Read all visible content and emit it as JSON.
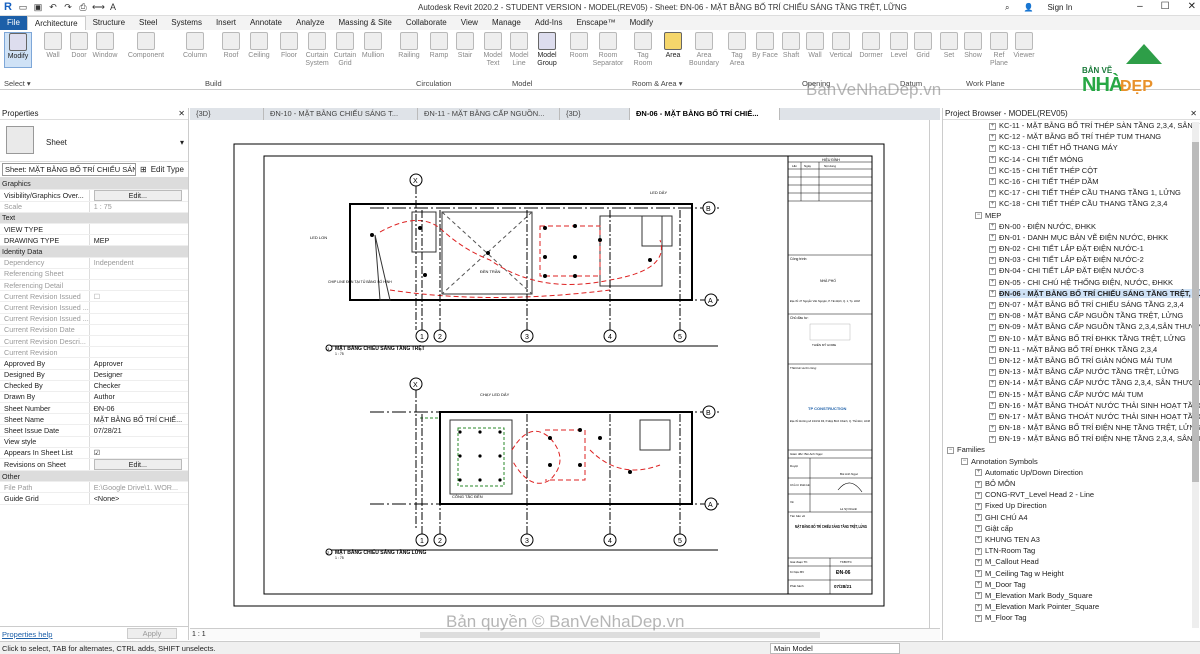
{
  "app": {
    "title": "Autodesk Revit 2020.2 - STUDENT VERSION - MODEL(REV05) - Sheet: ĐN-06 - MẶT BẰNG BỐ TRÍ CHIẾU SÁNG TẦNG TRỆT, LỮNG",
    "sign_in": "Sign In"
  },
  "tabs": [
    "File",
    "Architecture",
    "Structure",
    "Steel",
    "Systems",
    "Insert",
    "Annotate",
    "Analyze",
    "Massing & Site",
    "Collaborate",
    "View",
    "Manage",
    "Add-Ins",
    "Enscape™",
    "Modify"
  ],
  "ribbon": {
    "modify_label": "Modify",
    "tools": [
      "Wall",
      "Door",
      "Window",
      "Component",
      "Column",
      "Roof",
      "Ceiling",
      "Floor",
      "Curtain System",
      "Curtain Grid",
      "Mullion",
      "Railing",
      "Ramp",
      "Stair",
      "Model Text",
      "Model Line",
      "Model Group",
      "Room",
      "Room Separator",
      "Tag Room",
      "Area",
      "Area Boundary",
      "Tag Area",
      "By Face",
      "Shaft",
      "Wall",
      "Vertical",
      "Dormer",
      "Level",
      "Grid",
      "Set",
      "Show",
      "Ref Plane",
      "Viewer"
    ],
    "groups": [
      "Select ▾",
      "Build",
      "Circulation",
      "Model",
      "Room & Area ▾",
      "Opening",
      "Datum",
      "Work Plane"
    ]
  },
  "brand": {
    "top": "BẢN VẼ",
    "big": "NHÀ",
    "dep": "ĐẸP"
  },
  "properties": {
    "header": "Properties",
    "type_label": "Sheet",
    "instance": "Sheet: MẶT BẰNG BỐ TRÍ CHIẾU SÁN",
    "edit_type": "Edit Type",
    "rows": [
      {
        "sec": "Graphics"
      },
      {
        "k": "Visibility/Graphics Over...",
        "v": "Edit...",
        "btn": true
      },
      {
        "k": "Scale",
        "v": "1 : 75",
        "dim": true
      },
      {
        "sec": "Text"
      },
      {
        "k": "VIEW TYPE",
        "v": ""
      },
      {
        "k": "DRAWING TYPE",
        "v": "MEP"
      },
      {
        "sec": "Identity Data"
      },
      {
        "k": "Dependency",
        "v": "Independent",
        "dim": true
      },
      {
        "k": "Referencing Sheet",
        "v": "",
        "dim": true
      },
      {
        "k": "Referencing Detail",
        "v": "",
        "dim": true
      },
      {
        "k": "Current Revision Issued",
        "v": "☐",
        "dim": true
      },
      {
        "k": "Current Revision Issued ...",
        "v": "",
        "dim": true
      },
      {
        "k": "Current Revision Issued ...",
        "v": "",
        "dim": true
      },
      {
        "k": "Current Revision Date",
        "v": "",
        "dim": true
      },
      {
        "k": "Current Revision Descri...",
        "v": "",
        "dim": true
      },
      {
        "k": "Current Revision",
        "v": "",
        "dim": true
      },
      {
        "k": "Approved By",
        "v": "Approver"
      },
      {
        "k": "Designed By",
        "v": "Designer"
      },
      {
        "k": "Checked By",
        "v": "Checker"
      },
      {
        "k": "Drawn By",
        "v": "Author"
      },
      {
        "k": "Sheet Number",
        "v": "ĐN-06"
      },
      {
        "k": "Sheet Name",
        "v": "MẶT BẰNG BỐ TRÍ CHIẾ..."
      },
      {
        "k": "Sheet Issue Date",
        "v": "07/28/21"
      },
      {
        "k": "View style",
        "v": ""
      },
      {
        "k": "Appears In Sheet List",
        "v": "☑"
      },
      {
        "k": "Revisions on Sheet",
        "v": "Edit...",
        "btn": true
      },
      {
        "sec": "Other"
      },
      {
        "k": "File Path",
        "v": "E:\\Google Drive\\1. WOR...",
        "dim": true
      },
      {
        "k": "Guide Grid",
        "v": "<None>"
      }
    ],
    "help": "Properties help",
    "apply": "Apply"
  },
  "view_tabs": [
    "{3D}",
    "ĐN-10 - MẶT BẰNG CHIẾU SÁNG T...",
    "ĐN-11 - MẶT BẰNG CẤP NGUỒN...",
    "{3D}",
    "ĐN-06 - MẶT BẰNG BỐ TRÍ CHIẾ..."
  ],
  "sheet": {
    "plan1_title": "MẶT BẰNG CHIẾU SÁNG TẦNG TRỆT",
    "plan1_num": "1",
    "plan1_scale": "1 : 75",
    "plan2_title": "MẶT BẰNG CHIẾU SÁNG TẦNG LỬNG",
    "plan2_num": "2",
    "plan2_scale": "1 : 75",
    "grids": [
      "1",
      "2",
      "3",
      "4",
      "5"
    ],
    "grid_x": "X",
    "grid_a": "A",
    "grid_b": "B",
    "tb_rev": "HIỆU ĐÍNH",
    "tb_cols": [
      "Lần",
      "Ngày",
      "Nội dung"
    ],
    "tb_cty": "Công trình:",
    "tb_cty_val": "NHÀ PHỐ",
    "tb_addr": "Địa chỉ: 27 Nguyễn Văn Nguyện, P. Tân Định, Q. 1, Tp. HCM",
    "tb_owner": "Chủ đầu tư:",
    "tb_owner_val": "THIÊN MỸ HOME",
    "tb_design": "Thiết kế và thi công:",
    "tb_company": "TP CONSTRUCTION",
    "tb_caddr": "Địa chỉ: Đường số 1/10/11 D3, P.Hiệp Bình Chánh, Q. Thủ Đức, HCM",
    "tb_director": "Giám đốc: Bùi Anh Ngọc",
    "tb_duyet": "Duyệt",
    "tb_chutri": "Chủ trì thiết kế",
    "tb_ve": "Vẽ",
    "tb_n1": "Bùi Anh Ngọc",
    "tb_n2": "Lê Sỹ Khánh",
    "tb_name_lbl": "Tên bản vẽ",
    "tb_name": "MẶT BẰNG BỐ TRÍ CHIẾU SÁNG TẦNG TRỆT, LỬNG",
    "tb_phase": "Giai đoạn TK",
    "tb_phase_v": "TKBVTC",
    "tb_code": "Kí hiệu BV",
    "tb_code_v": "ĐN-06",
    "tb_date": "Phát hành",
    "tb_date_v": "07/28/21",
    "lbl_led_day": "LED DÂY",
    "lbl_led_lon": "LED LON",
    "lbl_den_tran": "ĐÈN TRẦN",
    "lbl_chip": "CHIP LINE ĐÈN TẠI TỦ BẰNG SỐ HÌNH",
    "lbl_chay": "CHẠY LED DÂY",
    "lbl_cong": "CÔNG TẮC ĐÈN"
  },
  "project_browser": {
    "header": "Project Browser - MODEL(REV05)",
    "items": [
      {
        "t": "KC-11 - MẶT BẰNG BỐ TRÍ THÉP SÀN TẦNG 2,3,4, SÂN THƯỢNG",
        "lvl": 3
      },
      {
        "t": "KC-12 - MẶT BẰNG BỐ TRÍ THÉP TUM THANG",
        "lvl": 3
      },
      {
        "t": "KC-13 - CHI TIẾT HỐ THANG MÁY",
        "lvl": 3
      },
      {
        "t": "KC-14 - CHI TIẾT MÓNG",
        "lvl": 3
      },
      {
        "t": "KC-15 - CHI TIẾT THÉP CỘT",
        "lvl": 3
      },
      {
        "t": "KC-16 - CHI TIẾT THÉP DẦM",
        "lvl": 3
      },
      {
        "t": "KC-17 - CHI TIẾT THÉP CẦU THANG TẦNG 1, LỬNG",
        "lvl": 3
      },
      {
        "t": "KC-18 - CHI TIẾT THÉP CẦU THANG TẦNG 2,3,4",
        "lvl": 3
      },
      {
        "t": "MEP",
        "lvl": 2,
        "open": true
      },
      {
        "t": "ĐN-00 - ĐIỆN NƯỚC, ĐHKK",
        "lvl": 3
      },
      {
        "t": "ĐN-01 - DANH MỤC BẢN VẼ ĐIỆN NƯỚC, ĐHKK",
        "lvl": 3
      },
      {
        "t": "ĐN-02 - CHI TIẾT LẮP ĐẶT ĐIỆN NƯỚC-1",
        "lvl": 3
      },
      {
        "t": "ĐN-03 - CHI TIẾT LẮP ĐẶT ĐIỆN NƯỚC-2",
        "lvl": 3
      },
      {
        "t": "ĐN-04 - CHI TIẾT LẮP ĐẶT ĐIỆN NƯỚC-3",
        "lvl": 3
      },
      {
        "t": "ĐN-05 - CHI CHÚ HỆ THỐNG ĐIỆN, NƯỚC, ĐHKK",
        "lvl": 3
      },
      {
        "t": "ĐN-06 - MẶT BẰNG BỐ TRÍ CHIẾU SÁNG TẦNG TRỆT, LỬNG",
        "lvl": 3,
        "sel": true
      },
      {
        "t": "ĐN-07 - MẶT BẰNG BỐ TRÍ CHIẾU SÁNG TẦNG 2,3,4",
        "lvl": 3
      },
      {
        "t": "ĐN-08 - MẶT BẰNG CẤP NGUỒN TẦNG TRỆT, LỬNG",
        "lvl": 3
      },
      {
        "t": "ĐN-09 - MẶT BẰNG CẤP NGUỒN TẦNG 2,3,4,SÂN THƯỢNG",
        "lvl": 3
      },
      {
        "t": "ĐN-10 - MẶT BẰNG BỐ TRÍ ĐHKK TẦNG TRỆT, LỬNG",
        "lvl": 3
      },
      {
        "t": "ĐN-11 - MẶT BẰNG BỐ TRÍ ĐHKK TẦNG 2,3,4",
        "lvl": 3
      },
      {
        "t": "ĐN-12 - MẶT BẰNG BỐ TRÍ GIÀN NÓNG MÁI TUM",
        "lvl": 3
      },
      {
        "t": "ĐN-13 - MẶT BẰNG CẤP NƯỚC TẦNG TRỆT, LỬNG",
        "lvl": 3
      },
      {
        "t": "ĐN-14 - MẶT BẰNG CẤP NƯỚC TẦNG 2,3,4, SÂN THƯỢNG",
        "lvl": 3
      },
      {
        "t": "ĐN-15 - MẶT BẰNG CẤP NƯỚC MÁI TUM",
        "lvl": 3
      },
      {
        "t": "ĐN-16 - MẶT BẰNG THOÁT NƯỚC THẢI SINH HOẠT TẦNG TRỆT",
        "lvl": 3
      },
      {
        "t": "ĐN-17 - MẶT BẰNG THOÁT NƯỚC THẢI SINH HOẠT TẦNG 2,3",
        "lvl": 3
      },
      {
        "t": "ĐN-18 - MẶT BẰNG BỐ TRÍ ĐIỆN NHẸ TẦNG TRỆT, LỬNG",
        "lvl": 3
      },
      {
        "t": "ĐN-19 - MẶT BẰNG BỐ TRÍ ĐIỆN NHẸ TẦNG 2,3,4, SÂN THƯỢNG",
        "lvl": 3
      },
      {
        "t": "Families",
        "lvl": 0,
        "open": true
      },
      {
        "t": "Annotation Symbols",
        "lvl": 1,
        "open": true
      },
      {
        "t": "Automatic Up/Down Direction",
        "lvl": 2
      },
      {
        "t": "BỎ MÔN",
        "lvl": 2
      },
      {
        "t": "CONG-RVT_Level Head 2 - Line",
        "lvl": 2
      },
      {
        "t": "Fixed Up Direction",
        "lvl": 2
      },
      {
        "t": "GHI CHÚ A4",
        "lvl": 2
      },
      {
        "t": "Giật cấp",
        "lvl": 2
      },
      {
        "t": "KHUNG TEN A3",
        "lvl": 2
      },
      {
        "t": "LTN-Room Tag",
        "lvl": 2
      },
      {
        "t": "M_Callout Head",
        "lvl": 2
      },
      {
        "t": "M_Ceiling Tag w Height",
        "lvl": 2
      },
      {
        "t": "M_Door Tag",
        "lvl": 2
      },
      {
        "t": "M_Elevation Mark Body_Square",
        "lvl": 2
      },
      {
        "t": "M_Elevation Mark Pointer_Square",
        "lvl": 2
      },
      {
        "t": "M_Floor Tag",
        "lvl": 2
      }
    ]
  },
  "view_bar": {
    "scale": "1 : 1"
  },
  "status": {
    "message": "Click to select, TAB for alternates, CTRL adds, SHIFT unselects.",
    "model": "Main Model"
  },
  "watermarks": {
    "site": "BanVeNhaDep.vn",
    "copy": "Bản quyền © BanVeNhaDep.vn"
  }
}
